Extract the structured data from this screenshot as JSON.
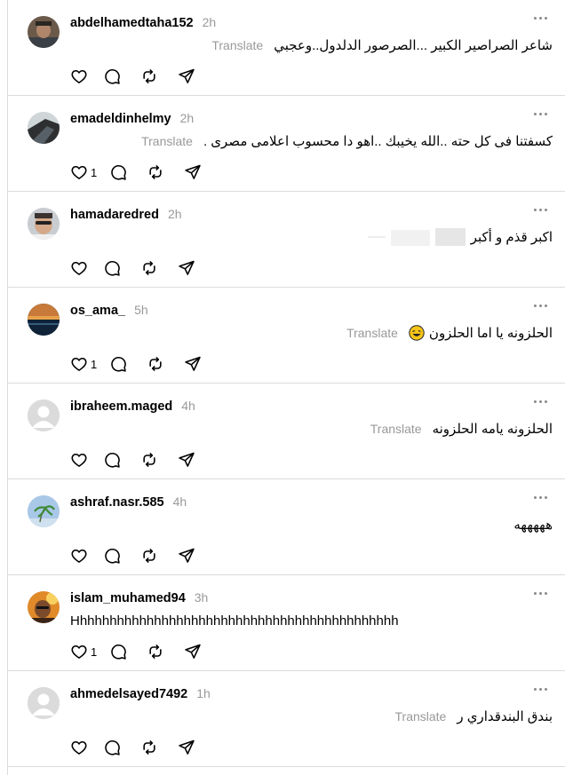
{
  "translate_label": "Translate",
  "posts": [
    {
      "username": "abdelhamedtaha152",
      "time": "2h",
      "text": "شاعر الصراصير الكبير ...الصرصور الدلدول..وعجبي",
      "translate": true,
      "likes": ""
    },
    {
      "username": "emadeldinhelmy",
      "time": "2h",
      "text": "كسفتنا فى كل حته ..الله يخيبك ..اهو دا محسوب اعلامى مصرى .",
      "translate": true,
      "likes": "1"
    },
    {
      "username": "hamadaredred",
      "time": "2h",
      "text": "اكبر قذم و أكبر",
      "translate": false,
      "likes": ""
    },
    {
      "username": "os_ama_",
      "time": "5h",
      "text": "الحلزونه يا اما الحلزون",
      "translate": true,
      "likes": "1"
    },
    {
      "username": "ibraheem.maged",
      "time": "4h",
      "text": "الحلزونه يامه الحلزونه",
      "translate": true,
      "likes": ""
    },
    {
      "username": "ashraf.nasr.585",
      "time": "4h",
      "text": "هههههه",
      "translate": false,
      "likes": ""
    },
    {
      "username": "islam_muhamed94",
      "time": "3h",
      "text": "Hhhhhhhhhhhhhhhhhhhhhhhhhhhhhhhhhhhhhhhhhhhh",
      "translate": false,
      "likes": "1"
    },
    {
      "username": "ahmedelsayed7492",
      "time": "1h",
      "text": "بندق البندقداري ر",
      "translate": true,
      "likes": ""
    }
  ],
  "icons": {
    "like": "heart-icon",
    "comment": "comment-bubble-icon",
    "repost": "repost-icon",
    "share": "send-icon",
    "more": "more-options-icon"
  }
}
